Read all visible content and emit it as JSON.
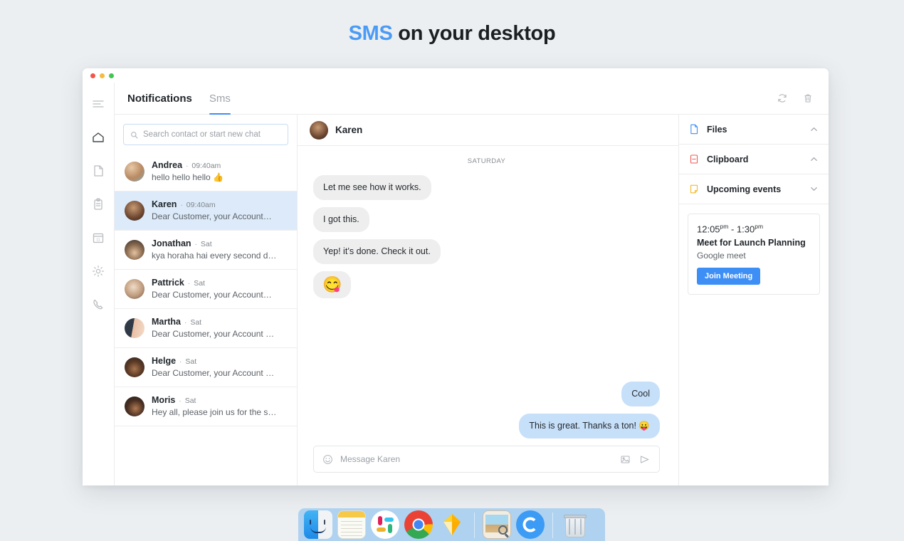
{
  "headline": {
    "accent": "SMS",
    "rest": " on your desktop"
  },
  "window": {
    "traffic_lights": [
      "close",
      "minimize",
      "zoom"
    ]
  },
  "rail": {
    "items": [
      {
        "name": "menu-icon",
        "label": "Menu",
        "active": false
      },
      {
        "name": "home-icon",
        "label": "Home",
        "active": true
      },
      {
        "name": "file-icon",
        "label": "Files",
        "active": false
      },
      {
        "name": "clipboard-icon",
        "label": "Clipboard",
        "active": false
      },
      {
        "name": "calendar-icon",
        "label": "Calendar",
        "active": false,
        "day": "11"
      },
      {
        "name": "gear-icon",
        "label": "Settings",
        "active": false
      },
      {
        "name": "phone-icon",
        "label": "Calls",
        "active": false
      }
    ]
  },
  "tabs": [
    {
      "label": "Notifications",
      "selected": false,
      "bold": true
    },
    {
      "label": "Sms",
      "selected": true,
      "bold": false
    }
  ],
  "toolbar": {
    "refresh_label": "Refresh",
    "delete_label": "Delete"
  },
  "search": {
    "placeholder": "Search contact or start new chat",
    "value": ""
  },
  "conversations": [
    {
      "name": "Andrea",
      "time": "09:40am",
      "preview": "hello hello hello 👍",
      "active": false,
      "avatar": "andrea"
    },
    {
      "name": "Karen",
      "time": "09:40am",
      "preview": "Dear Customer, your Account…",
      "active": true,
      "avatar": "karen"
    },
    {
      "name": "Jonathan",
      "time": "Sat",
      "preview": "kya horaha hai every second d…",
      "active": false,
      "avatar": "jonathan"
    },
    {
      "name": "Pattrick",
      "time": "Sat",
      "preview": "Dear Customer, your Account…",
      "active": false,
      "avatar": "pattrick"
    },
    {
      "name": "Martha",
      "time": "Sat",
      "preview": "Dear Customer, your Account …",
      "active": false,
      "avatar": "martha"
    },
    {
      "name": "Helge",
      "time": "Sat",
      "preview": "Dear Customer, your Account …",
      "active": false,
      "avatar": "helge"
    },
    {
      "name": "Moris",
      "time": "Sat",
      "preview": "Hey all, please join us for the s…",
      "active": false,
      "avatar": "moris"
    }
  ],
  "chat": {
    "contact": "Karen",
    "day_separator": "SATURDAY",
    "messages": [
      {
        "text": "Let me see how it works.",
        "dir": "in",
        "emoji": false
      },
      {
        "text": "I got this.",
        "dir": "in",
        "emoji": false
      },
      {
        "text": "Yep! it’s done. Check it out.",
        "dir": "in",
        "emoji": false
      },
      {
        "text": "😋",
        "dir": "in",
        "emoji": true
      },
      {
        "text": "Cool",
        "dir": "out",
        "emoji": false
      },
      {
        "text": "This is great. Thanks a ton! 😛",
        "dir": "out",
        "emoji": false
      }
    ],
    "composer": {
      "placeholder": "Message Karen",
      "value": "",
      "emoji_label": "Emoji",
      "image_label": "Attach image",
      "send_label": "Send"
    }
  },
  "right_panel": {
    "sections": [
      {
        "label": "Files",
        "icon": "file-icon",
        "chevron": "up",
        "color": "#3d8ef5"
      },
      {
        "label": "Clipboard",
        "icon": "clipboard-icon",
        "chevron": "up",
        "color": "#f05a4f"
      },
      {
        "label": "Upcoming events",
        "icon": "note-icon",
        "chevron": "down",
        "color": "#f5b929"
      }
    ],
    "event": {
      "start_time": "12:05",
      "start_suffix": "pm",
      "dash": " - ",
      "end_time": "1:30",
      "end_suffix": "pm",
      "title": "Meet for Launch Planning",
      "subtitle": "Google meet",
      "button": "Join Meeting"
    }
  },
  "dock": {
    "items": [
      {
        "name": "finder-icon",
        "label": "Finder"
      },
      {
        "name": "notes-icon",
        "label": "Notes"
      },
      {
        "name": "slack-icon",
        "label": "Slack"
      },
      {
        "name": "chrome-icon",
        "label": "Google Chrome"
      },
      {
        "name": "sketch-icon",
        "label": "Sketch"
      },
      {
        "name": "preview-icon",
        "label": "Preview"
      },
      {
        "name": "cleanmymac-icon",
        "label": "CleanMyMac"
      },
      {
        "name": "trash-icon",
        "label": "Trash"
      }
    ]
  },
  "colors": {
    "accent": "#3d8ef5",
    "headline_accent": "#4a9bf5",
    "selected_row": "#dceaf9",
    "bubble_in": "#eeeeee",
    "bubble_out": "#c7e0f9",
    "page_bg": "#eceff1",
    "dock_bg": "#aed2f0"
  }
}
